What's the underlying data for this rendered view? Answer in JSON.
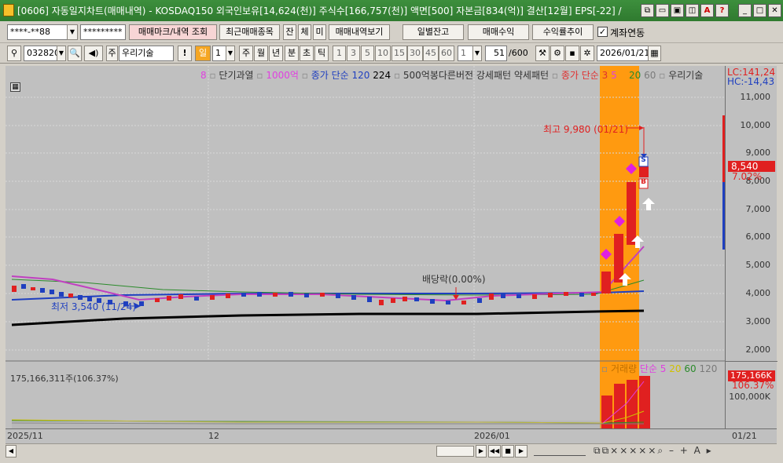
{
  "title_bar": {
    "text": "[0606] 자동일지차트(매매내역) - KOSDAQ150 외국인보유[14,624(천)] 주식수[166,757(천)] 액면[500] 자본금[834(억)] 결산[12월] EPS[-22] /"
  },
  "toolbar1": {
    "account": "****-**88",
    "password": "*********",
    "trade_mark_btn": "매매마크/내역 조회",
    "recent_btn": "최근매매종목",
    "bal_btn": "잔",
    "exec_btn": "체",
    "unexec_btn": "미",
    "history_btn": "매매내역보기",
    "daily_btn": "일별잔고",
    "profit_btn": "매매수익",
    "trend_btn": "수익률추이",
    "link_label": "계좌연동"
  },
  "toolbar2": {
    "code": "032820",
    "stock_name": "우리기술",
    "prefix": "주",
    "excl": "!",
    "period_day": "일",
    "period_num": "1",
    "periods": [
      "주",
      "월",
      "년",
      "분",
      "초",
      "틱"
    ],
    "intervals": [
      "1",
      "3",
      "5",
      "10",
      "15",
      "30",
      "45",
      "60"
    ],
    "interval_sel": "1",
    "count": "51",
    "count_max": "/600",
    "date": "2026/01/21"
  },
  "price_legend": [
    {
      "text": "8",
      "color": "#e040e0"
    },
    {
      "text": "단기과열",
      "color": "#333333"
    },
    {
      "text": "1000억",
      "color": "#e040e0"
    },
    {
      "text": "종가 단순 120",
      "color": "#1f3fbf"
    },
    {
      "text": "224",
      "color": "#000000"
    },
    {
      "text": "500억봉다른버전",
      "color": "#333333"
    },
    {
      "text": "강세패턴",
      "color": "#333333"
    },
    {
      "text": "약세패턴",
      "color": "#333333"
    },
    {
      "text": "종가 단순 3",
      "color": "#e03030"
    },
    {
      "text": "5",
      "color": "#e040e0"
    },
    {
      "text": "20",
      "color": "#2a8a2a"
    },
    {
      "text": "60",
      "color": "#7a7a7a"
    },
    {
      "text": "우리기술",
      "color": "#333333"
    }
  ],
  "lc_label": "LC:141,24",
  "hc_label": "HC:-14,43",
  "price_axis": [
    "11,000",
    "10,000",
    "9,000",
    "8,000",
    "7,000",
    "6,000",
    "5,000",
    "4,000",
    "3,000",
    "2,000"
  ],
  "price_tag": {
    "price": "8,540",
    "pct": "7.02%"
  },
  "annotations": {
    "high": "최고 9,980 (01/21)",
    "low": "최저 3,540 (11/24)",
    "dividend": "배당락(0.00%)",
    "sell_mark": "S",
    "buy_mark": "B"
  },
  "volume": {
    "label": "175,166,311주(106.37%)",
    "legend": [
      {
        "text": "거래량",
        "color": "#d08000"
      },
      {
        "text": "단순 5",
        "color": "#e040e0"
      },
      {
        "text": "20",
        "color": "#d0c000"
      },
      {
        "text": "60",
        "color": "#2a8a2a"
      },
      {
        "text": "120",
        "color": "#7a7a7a"
      }
    ],
    "tag_value": "175,166K",
    "tag_pct": "106.37%",
    "axis_100k": "100,000K"
  },
  "date_axis": {
    "d1": "2025/11",
    "d2": "12",
    "d3": "2026/01",
    "last": "01/21"
  },
  "chart_data": {
    "type": "candlestick",
    "ylim": [
      1500,
      11500
    ],
    "high": 9980,
    "low": 3540,
    "last": 8540,
    "last_change_pct": 7.02,
    "last_volume": 175166311,
    "last_volume_pct": 106.37
  },
  "colors": {
    "up": "#e02020",
    "down": "#1f3fbf",
    "highlight": "#ff8c00",
    "title_bg": "#2f7a2f"
  }
}
